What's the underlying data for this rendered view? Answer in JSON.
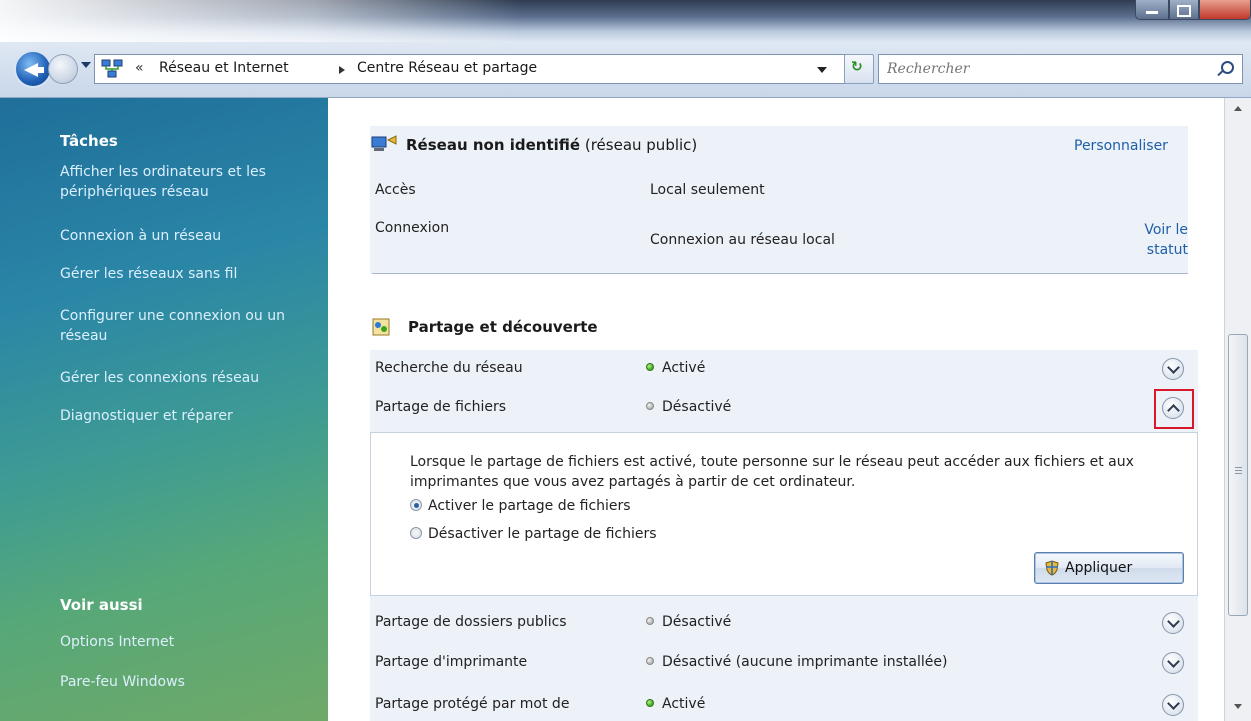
{
  "window": {
    "title": ""
  },
  "address_bar": {
    "overflow": "«",
    "crumbs": [
      "Réseau et Internet",
      "Centre Réseau et partage"
    ]
  },
  "search": {
    "placeholder": "Rechercher"
  },
  "left_pane": {
    "tasks_title": "Tâches",
    "task_links": [
      "Afficher les ordinateurs et les périphériques réseau",
      "Connexion à un réseau",
      "Gérer les réseaux sans fil",
      "Configurer une connexion ou un réseau",
      "Gérer les connexions réseau",
      "Diagnostiquer et réparer"
    ],
    "see_also_title": "Voir aussi",
    "see_also_links": [
      "Options Internet",
      "Pare-feu Windows"
    ]
  },
  "network": {
    "name": "Réseau non identifié",
    "type": "(réseau public)",
    "customize": "Personnaliser",
    "rows": [
      {
        "label": "Accès",
        "value": "Local seulement"
      },
      {
        "label": "Connexion",
        "value": "Connexion au réseau local",
        "link": "Voir le statut"
      }
    ]
  },
  "sharing": {
    "title": "Partage et découverte",
    "rows": [
      {
        "label": "Recherche du réseau",
        "status": "Activé",
        "state": "on"
      },
      {
        "label": "Partage de fichiers",
        "status": "Désactivé",
        "state": "off",
        "expanded": true
      }
    ],
    "file_sharing_panel": {
      "description": "Lorsque le partage de fichiers est activé, toute personne sur le réseau peut accéder aux fichiers et aux imprimantes que vous avez partagés à partir de cet ordinateur.",
      "options": [
        {
          "label": "Activer le partage de fichiers",
          "selected": true
        },
        {
          "label": "Désactiver le partage de fichiers",
          "selected": false
        }
      ],
      "apply_label": "Appliquer"
    },
    "rows_after": [
      {
        "label": "Partage de dossiers publics",
        "status": "Désactivé",
        "state": "off"
      },
      {
        "label": "Partage d'imprimante",
        "status": "Désactivé (aucune imprimante installée)",
        "state": "off"
      },
      {
        "label": "Partage protégé par mot de",
        "status": "Activé",
        "state": "on"
      }
    ]
  },
  "colors": {
    "link": "#1d5fa8",
    "highlight": "#d9182b",
    "status_on": "#3aa51a"
  }
}
